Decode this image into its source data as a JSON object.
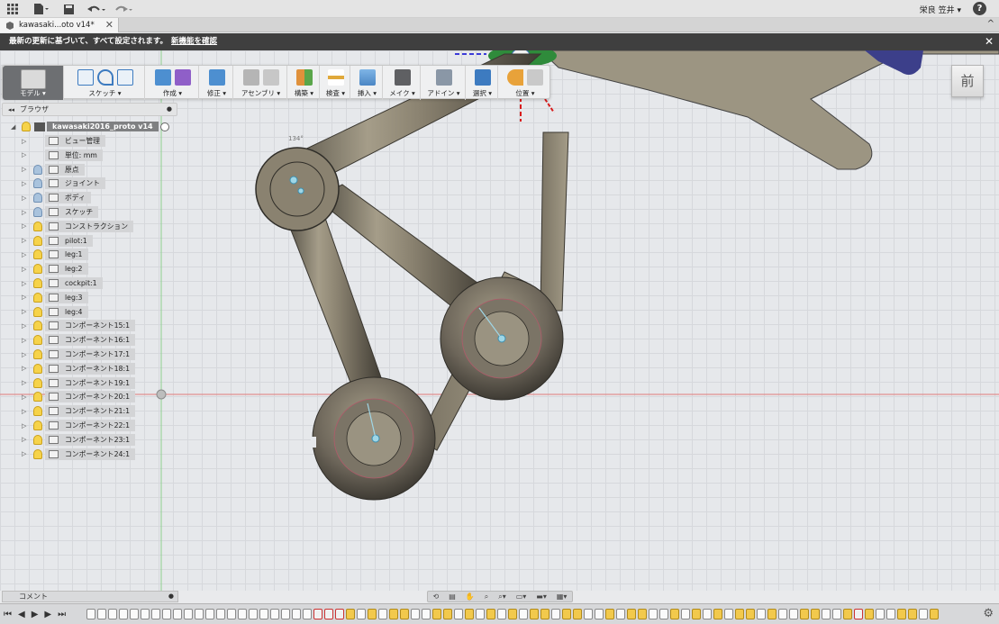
{
  "topbar": {
    "user": "栄良 笠井 ▾",
    "help": "?"
  },
  "tab": {
    "title": "kawasaki...oto v14*",
    "close": "✕"
  },
  "notice": {
    "text": "最新の更新に基づいて、すべて設定されます。",
    "link": "新機能を確認",
    "close": "✕"
  },
  "toolbar": {
    "groups": [
      {
        "label": "モデル ▾"
      },
      {
        "label": "スケッチ ▾"
      },
      {
        "label": "作成 ▾"
      },
      {
        "label": "修正 ▾"
      },
      {
        "label": "アセンブリ ▾"
      },
      {
        "label": "構築 ▾"
      },
      {
        "label": "検査 ▾"
      },
      {
        "label": "挿入 ▾"
      },
      {
        "label": "メイク ▾"
      },
      {
        "label": "アドイン ▾"
      },
      {
        "label": "選択 ▾"
      },
      {
        "label": "位置 ▾"
      }
    ]
  },
  "viewcube": {
    "face": "前"
  },
  "browser": {
    "title": "ブラウザ",
    "root": "kawasaki2016_proto v14",
    "items": [
      {
        "label": "ビュー管理",
        "bulb": "none"
      },
      {
        "label": "単位: mm",
        "bulb": "none"
      },
      {
        "label": "原点",
        "bulb": "off"
      },
      {
        "label": "ジョイント",
        "bulb": "off"
      },
      {
        "label": "ボディ",
        "bulb": "off"
      },
      {
        "label": "スケッチ",
        "bulb": "off"
      },
      {
        "label": "コンストラクション",
        "bulb": "on"
      },
      {
        "label": "pilot:1",
        "bulb": "on"
      },
      {
        "label": "leg:1",
        "bulb": "on"
      },
      {
        "label": "leg:2",
        "bulb": "on"
      },
      {
        "label": "cockpit:1",
        "bulb": "on"
      },
      {
        "label": "leg:3",
        "bulb": "on"
      },
      {
        "label": "leg:4",
        "bulb": "on"
      },
      {
        "label": "コンポーネント15:1",
        "bulb": "on"
      },
      {
        "label": "コンポーネント16:1",
        "bulb": "on"
      },
      {
        "label": "コンポーネント17:1",
        "bulb": "on"
      },
      {
        "label": "コンポーネント18:1",
        "bulb": "on"
      },
      {
        "label": "コンポーネント19:1",
        "bulb": "on"
      },
      {
        "label": "コンポーネント20:1",
        "bulb": "on"
      },
      {
        "label": "コンポーネント21:1",
        "bulb": "on"
      },
      {
        "label": "コンポーネント22:1",
        "bulb": "on"
      },
      {
        "label": "コンポーネント23:1",
        "bulb": "on"
      },
      {
        "label": "コンポーネント24:1",
        "bulb": "on"
      }
    ]
  },
  "comment": {
    "label": "コメント"
  },
  "canvas": {
    "angle_label": "134°"
  },
  "colors": {
    "model_tab": "#6d6f72",
    "select_icon": "#3d7bc0",
    "bulb_on": "#f6d34a",
    "bulb_off": "#a9c3dd",
    "notice_bg": "#3f3f3f",
    "metal": "#8a8270"
  }
}
